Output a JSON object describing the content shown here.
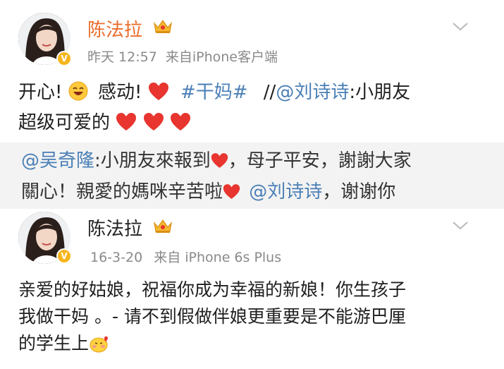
{
  "post1": {
    "author": "陈法拉",
    "time": "昨天 12:57",
    "source": "来自iPhone客户端",
    "line1_a": "开心!",
    "line1_b": "感动!",
    "hashtag": "#干妈#",
    "repost_prefix": "//",
    "mention": "@刘诗诗",
    "line1_c": ":小朋友",
    "line2": "超级可爱的",
    "avatar_icon": "avatar-photo",
    "crown_icon": "crown-icon",
    "verified_icon": "verified-v-icon"
  },
  "quote": {
    "mention": "@吴奇隆",
    "line1_a": ":小朋友來報到",
    "line1_b": "，母子平安，謝謝大家",
    "line2_a": "關心！親愛的媽咪辛苦啦",
    "mention2": "@刘诗诗",
    "line2_b": "，谢谢你"
  },
  "post2": {
    "author": "陈法拉",
    "time": "16-3-20",
    "source": "来自 iPhone 6s Plus",
    "line1": "亲爱的好姑娘，祝福你成为幸福的新娘！你生孩子",
    "line2": "我做干妈 。- 请不到假做伴娘更重要是不能游巴厘",
    "line3": "的学生上"
  },
  "colors": {
    "name": "#ea6d2c",
    "link": "#4a7fb6",
    "meta": "#8a8a8a",
    "heart": "#e8352f",
    "quote_bg": "#f3f3f3"
  }
}
